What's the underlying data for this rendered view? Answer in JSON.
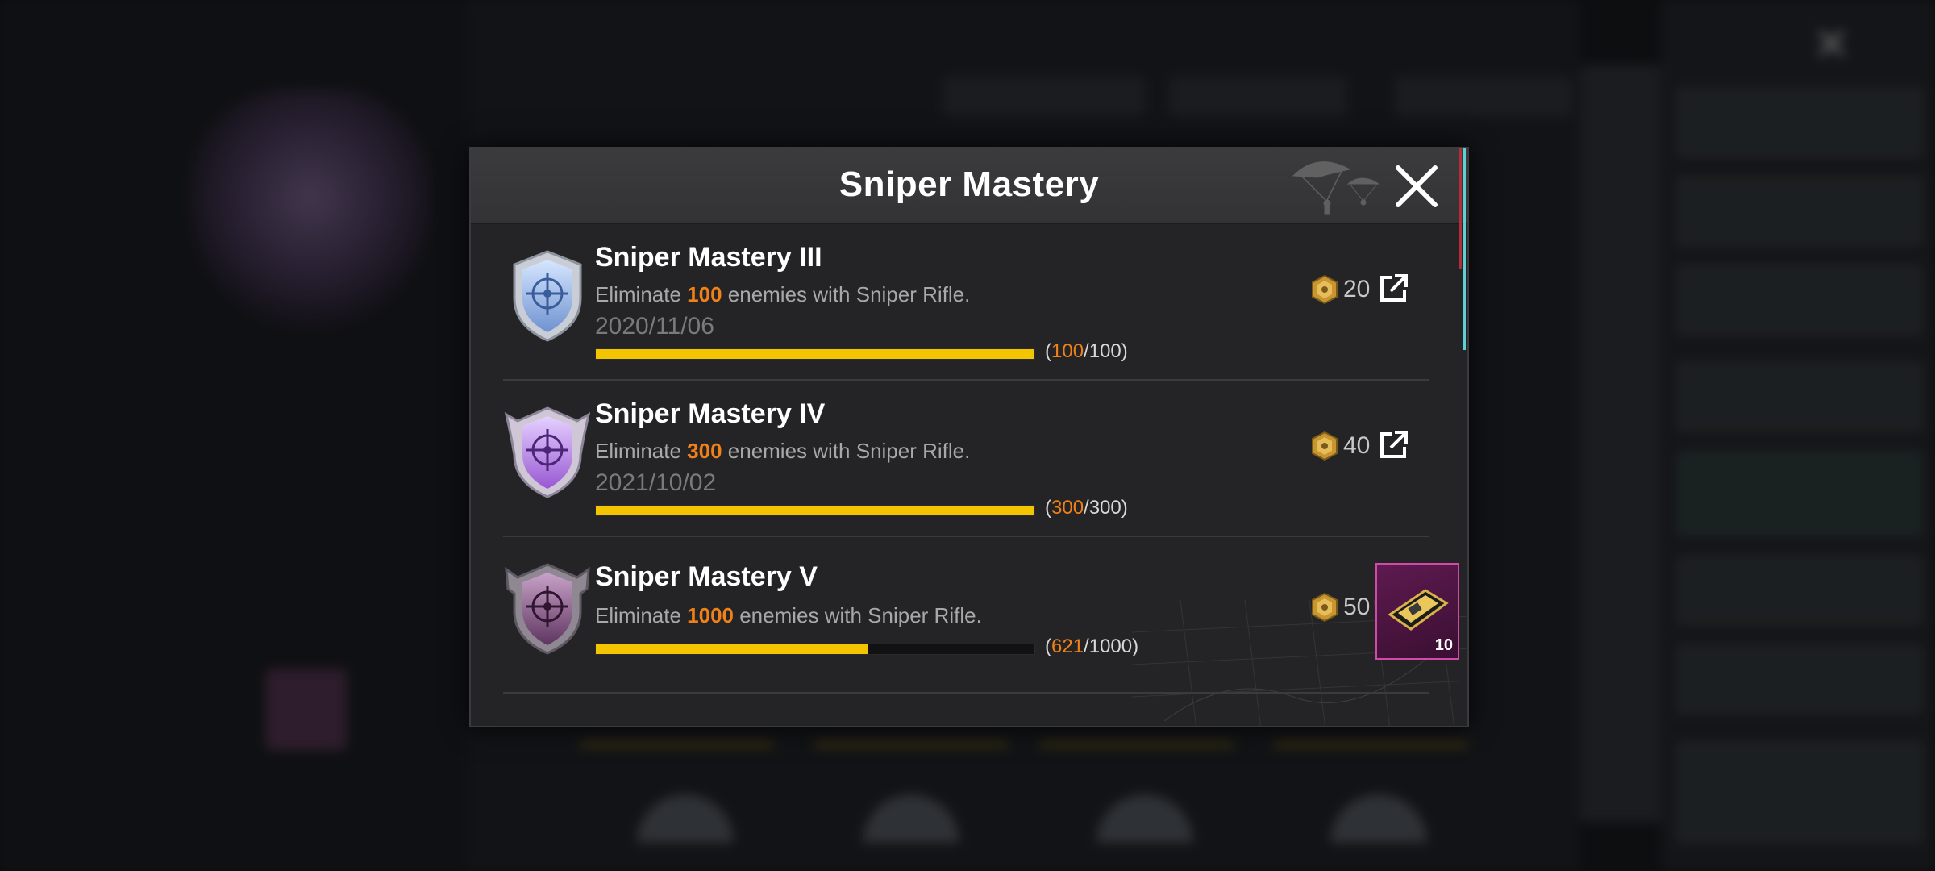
{
  "modal": {
    "title": "Sniper Mastery"
  },
  "achievements": [
    {
      "name": "Sniper Mastery III",
      "desc_prefix": "Eliminate ",
      "target": "100",
      "desc_suffix": " enemies with Sniper Rifle.",
      "date": "2020/11/06",
      "progress_current": "100",
      "progress_total": "/100)",
      "progress_open": "(",
      "progress_fraction": 1.0,
      "reward_points": "20",
      "badge_color": "#8fb4e8"
    },
    {
      "name": "Sniper Mastery IV",
      "desc_prefix": "Eliminate ",
      "target": "300",
      "desc_suffix": " enemies with Sniper Rifle.",
      "date": "2021/10/02",
      "progress_current": "300",
      "progress_total": "/300)",
      "progress_open": "(",
      "progress_fraction": 1.0,
      "reward_points": "40",
      "badge_color": "#b27fe0"
    },
    {
      "name": "Sniper Mastery V",
      "desc_prefix": "Eliminate ",
      "target": "1000",
      "desc_suffix": " enemies with Sniper Rifle.",
      "progress_current": "621",
      "progress_total": "/1000)",
      "progress_open": "(",
      "progress_fraction": 0.621,
      "reward_points": "50",
      "reward_item_qty": "10",
      "badge_color": "#8a5a8c"
    }
  ],
  "colors": {
    "accent_orange": "#f08018",
    "progress_yellow": "#f3c500",
    "item_border": "#d04aa8"
  }
}
